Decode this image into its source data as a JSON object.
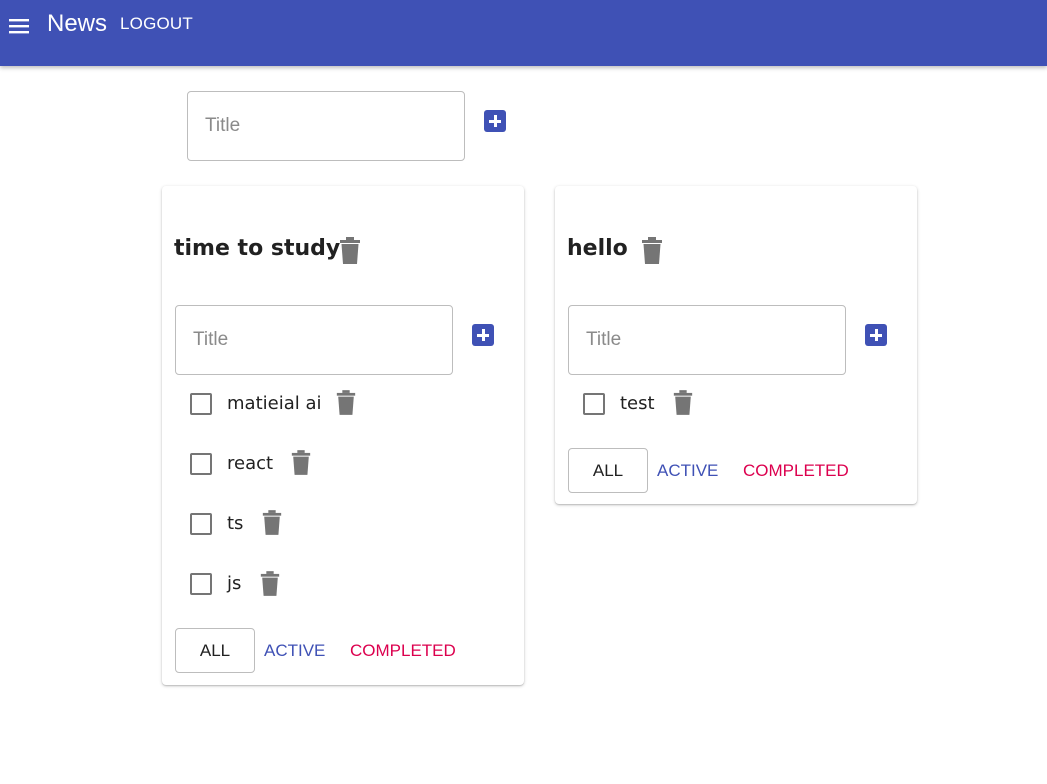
{
  "appbar": {
    "menu_icon": "menu-icon",
    "title": "News",
    "logout_label": "LOGOUT"
  },
  "new_todolist": {
    "placeholder": "Title",
    "add_icon": "add-box-icon"
  },
  "todolists": [
    {
      "title": "time to study",
      "input_placeholder": "Title",
      "tasks": [
        {
          "label": "matieial ai",
          "checked": false
        },
        {
          "label": "react",
          "checked": false
        },
        {
          "label": "ts",
          "checked": false
        },
        {
          "label": "js",
          "checked": false
        }
      ],
      "filters": {
        "all": "ALL",
        "active": "ACTIVE",
        "completed": "COMPLETED"
      }
    },
    {
      "title": "hello",
      "input_placeholder": "Title",
      "tasks": [
        {
          "label": "test",
          "checked": false
        }
      ],
      "filters": {
        "all": "ALL",
        "active": "ACTIVE",
        "completed": "COMPLETED"
      }
    }
  ],
  "colors": {
    "primary": "#3f51b5",
    "secondary": "#dc004e",
    "icon_gray": "#757575"
  }
}
